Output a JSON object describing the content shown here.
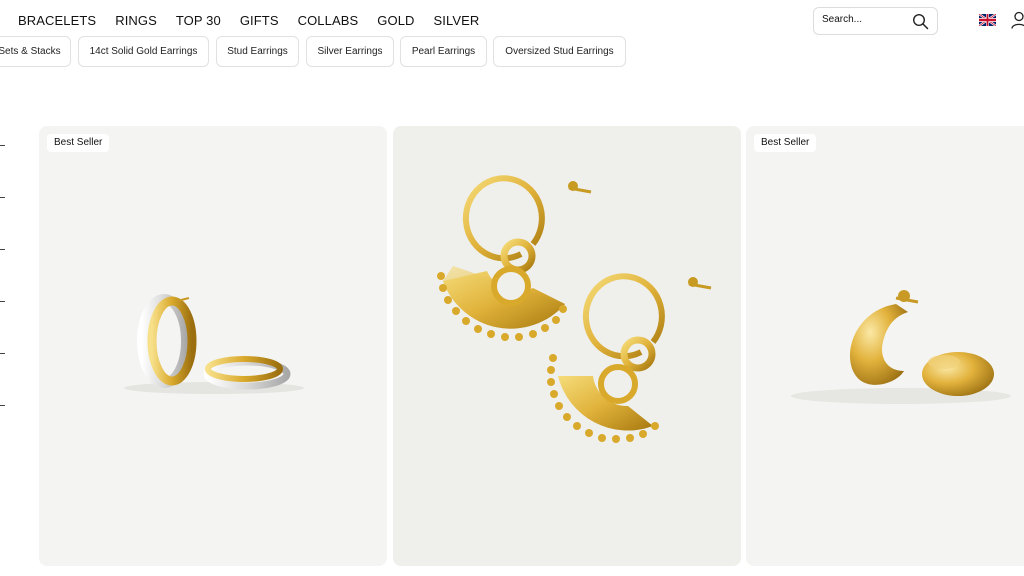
{
  "nav": {
    "links": [
      "BRACELETS",
      "RINGS",
      "TOP 30",
      "GIFTS",
      "COLLABS",
      "GOLD",
      "SILVER"
    ]
  },
  "search": {
    "placeholder": "Search..."
  },
  "icons": {
    "search": "search-icon",
    "flag": "uk-flag-icon",
    "account": "account-icon"
  },
  "chips": [
    "Sets & Stacks",
    "14ct Solid Gold Earrings",
    "Stud Earrings",
    "Silver Earrings",
    "Pearl Earrings",
    "Oversized Stud Earrings"
  ],
  "products": [
    {
      "badge": "Best Seller"
    },
    {
      "badge": ""
    },
    {
      "badge": "Best Seller"
    }
  ],
  "colors": {
    "gold": "#d9a92c",
    "silver": "#d6d6d6",
    "card_bg": "#f4f4f2"
  }
}
